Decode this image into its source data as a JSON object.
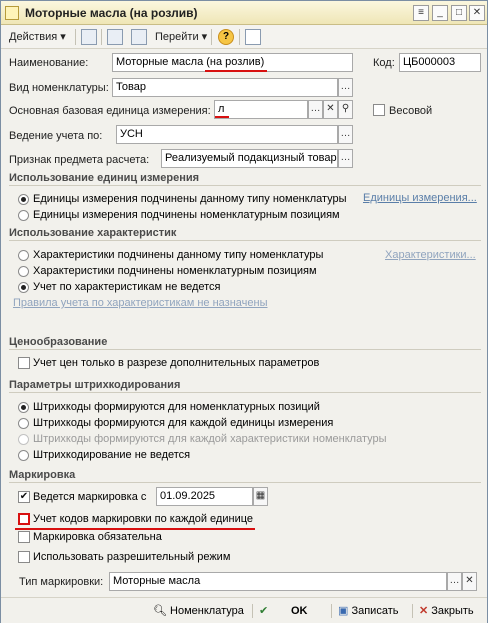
{
  "window": {
    "title": "Моторные масла (на розлив)"
  },
  "toolbar": {
    "actions": "Действия",
    "goto": "Перейти",
    "help": "?"
  },
  "form": {
    "name_label": "Наименование:",
    "name_value": "Моторные масла (на розлив)",
    "code_label": "Код:",
    "code_value": "ЦБ000003",
    "type_label": "Вид номенклатуры:",
    "type_value": "Товар",
    "unit_label": "Основная базовая единица измерения:",
    "unit_value": "л",
    "weight_label": "Весовой",
    "accounting_label": "Ведение учета по:",
    "accounting_value": "УСН",
    "subject_label": "Признак предмета расчета:",
    "subject_value": "Реализуемый подакцизный товар"
  },
  "units_section": {
    "title": "Использование единиц измерения",
    "options": [
      "Единицы измерения подчинены данному типу номенклатуры",
      "Единицы измерения подчинены номенклатурным позициям"
    ],
    "link": "Единицы измерения..."
  },
  "chars_section": {
    "title": "Использование характеристик",
    "options": [
      "Характеристики подчинены данному типу номенклатуры",
      "Характеристики подчинены номенклатурным позициям",
      "Учет по характеристикам не ведется"
    ],
    "link": "Характеристики...",
    "rules_link": "Правила учета по характеристикам не назначены"
  },
  "pricing_section": {
    "title": "Ценообразование",
    "option": "Учет цен только в разрезе дополнительных параметров"
  },
  "barcode_section": {
    "title": "Параметры штрихкодирования",
    "options": [
      "Штрихкоды формируются для номенклатурных позиций",
      "Штрихкоды формируются для каждой единицы измерения",
      "Штрихкоды формируются для каждой характеристики номенклатуры",
      "Штрихкодирование не ведется"
    ]
  },
  "marking_section": {
    "title": "Маркировка",
    "enabled_label": "Ведется маркировка с",
    "enabled_date": "01.09.2025",
    "per_unit_label": "Учет кодов маркировки по каждой единице",
    "mandatory_label": "Маркировка обязательна",
    "permissive_label": "Использовать разрешительный режим",
    "type_label": "Тип маркировки:",
    "type_value": "Моторные масла"
  },
  "bottom": {
    "nomenclature": "Номенклатура",
    "ok": "OK",
    "save": "Записать",
    "close": "Закрыть"
  },
  "colors": {
    "annotation": "#d81010",
    "link": "#5a7ea8"
  }
}
